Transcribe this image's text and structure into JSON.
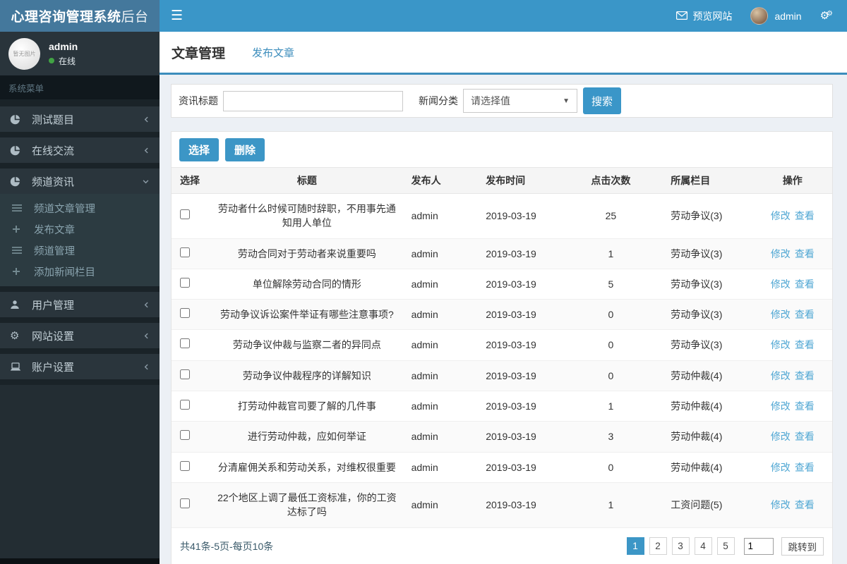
{
  "app": {
    "title_bold": "心理咨询管理系统",
    "title_light": "后台"
  },
  "header": {
    "preview_label": "预览网站",
    "username": "admin"
  },
  "sidebar": {
    "user": {
      "name": "admin",
      "status": "在线",
      "avatar_placeholder": "暂无图片"
    },
    "section_label": "系统菜单",
    "items": [
      {
        "label": "测试题目",
        "icon": "pie-chart-icon",
        "chevron": "left"
      },
      {
        "label": "在线交流",
        "icon": "pie-chart-icon",
        "chevron": "left"
      },
      {
        "label": "频道资讯",
        "icon": "pie-chart-icon",
        "chevron": "down",
        "expanded": true,
        "children": [
          {
            "label": "频道文章管理",
            "icon": "list-icon"
          },
          {
            "label": "发布文章",
            "icon": "plus-icon"
          },
          {
            "label": "频道管理",
            "icon": "list-icon"
          },
          {
            "label": "添加新闻栏目",
            "icon": "plus-icon"
          }
        ]
      },
      {
        "label": "用户管理",
        "icon": "user-icon",
        "chevron": "left"
      },
      {
        "label": "网站设置",
        "icon": "gear-icon",
        "chevron": "left"
      },
      {
        "label": "账户设置",
        "icon": "laptop-icon",
        "chevron": "left"
      }
    ]
  },
  "tabs": [
    {
      "label": "文章管理",
      "active": true
    },
    {
      "label": "发布文章",
      "active": false
    }
  ],
  "filter": {
    "title_label": "资讯标题",
    "title_value": "",
    "category_label": "新闻分类",
    "category_value": "请选择值",
    "search_label": "搜索"
  },
  "toolbar": {
    "select_label": "选择",
    "delete_label": "删除"
  },
  "table": {
    "headers": [
      "选择",
      "标题",
      "发布人",
      "发布时间",
      "点击次数",
      "所属栏目",
      "操作"
    ],
    "action_labels": [
      "修改",
      "查看"
    ],
    "rows": [
      {
        "title": "劳动者什么时候可随时辞职，不用事先通知用人单位",
        "publisher": "admin",
        "date": "2019-03-19",
        "clicks": "25",
        "category": "劳动争议(3)"
      },
      {
        "title": "劳动合同对于劳动者来说重要吗",
        "publisher": "admin",
        "date": "2019-03-19",
        "clicks": "1",
        "category": "劳动争议(3)"
      },
      {
        "title": "单位解除劳动合同的情形",
        "publisher": "admin",
        "date": "2019-03-19",
        "clicks": "5",
        "category": "劳动争议(3)"
      },
      {
        "title": "劳动争议诉讼案件举证有哪些注意事项?",
        "publisher": "admin",
        "date": "2019-03-19",
        "clicks": "0",
        "category": "劳动争议(3)"
      },
      {
        "title": "劳动争议仲裁与监察二者的异同点",
        "publisher": "admin",
        "date": "2019-03-19",
        "clicks": "0",
        "category": "劳动争议(3)"
      },
      {
        "title": "劳动争议仲裁程序的详解知识",
        "publisher": "admin",
        "date": "2019-03-19",
        "clicks": "0",
        "category": "劳动仲裁(4)"
      },
      {
        "title": "打劳动仲裁官司要了解的几件事",
        "publisher": "admin",
        "date": "2019-03-19",
        "clicks": "1",
        "category": "劳动仲裁(4)"
      },
      {
        "title": "进行劳动仲裁，应如何举证",
        "publisher": "admin",
        "date": "2019-03-19",
        "clicks": "3",
        "category": "劳动仲裁(4)"
      },
      {
        "title": "分清雇佣关系和劳动关系，对维权很重要",
        "publisher": "admin",
        "date": "2019-03-19",
        "clicks": "0",
        "category": "劳动仲裁(4)"
      },
      {
        "title": "22个地区上调了最低工资标准，你的工资达标了吗",
        "publisher": "admin",
        "date": "2019-03-19",
        "clicks": "1",
        "category": "工资问题(5)"
      }
    ]
  },
  "pagination": {
    "summary": "共41条-5页-每页10条",
    "pages": [
      "1",
      "2",
      "3",
      "4",
      "5"
    ],
    "active_page": "1",
    "jump_value": "1",
    "jump_label": "跳转到"
  },
  "colors": {
    "header_bg": "#3a96c8",
    "logo_bg": "#44789c",
    "accent": "#3c8dbc",
    "link_blue": "#4ea6d3",
    "sidebar_bg": "#232d33",
    "status_green": "#41a344"
  }
}
